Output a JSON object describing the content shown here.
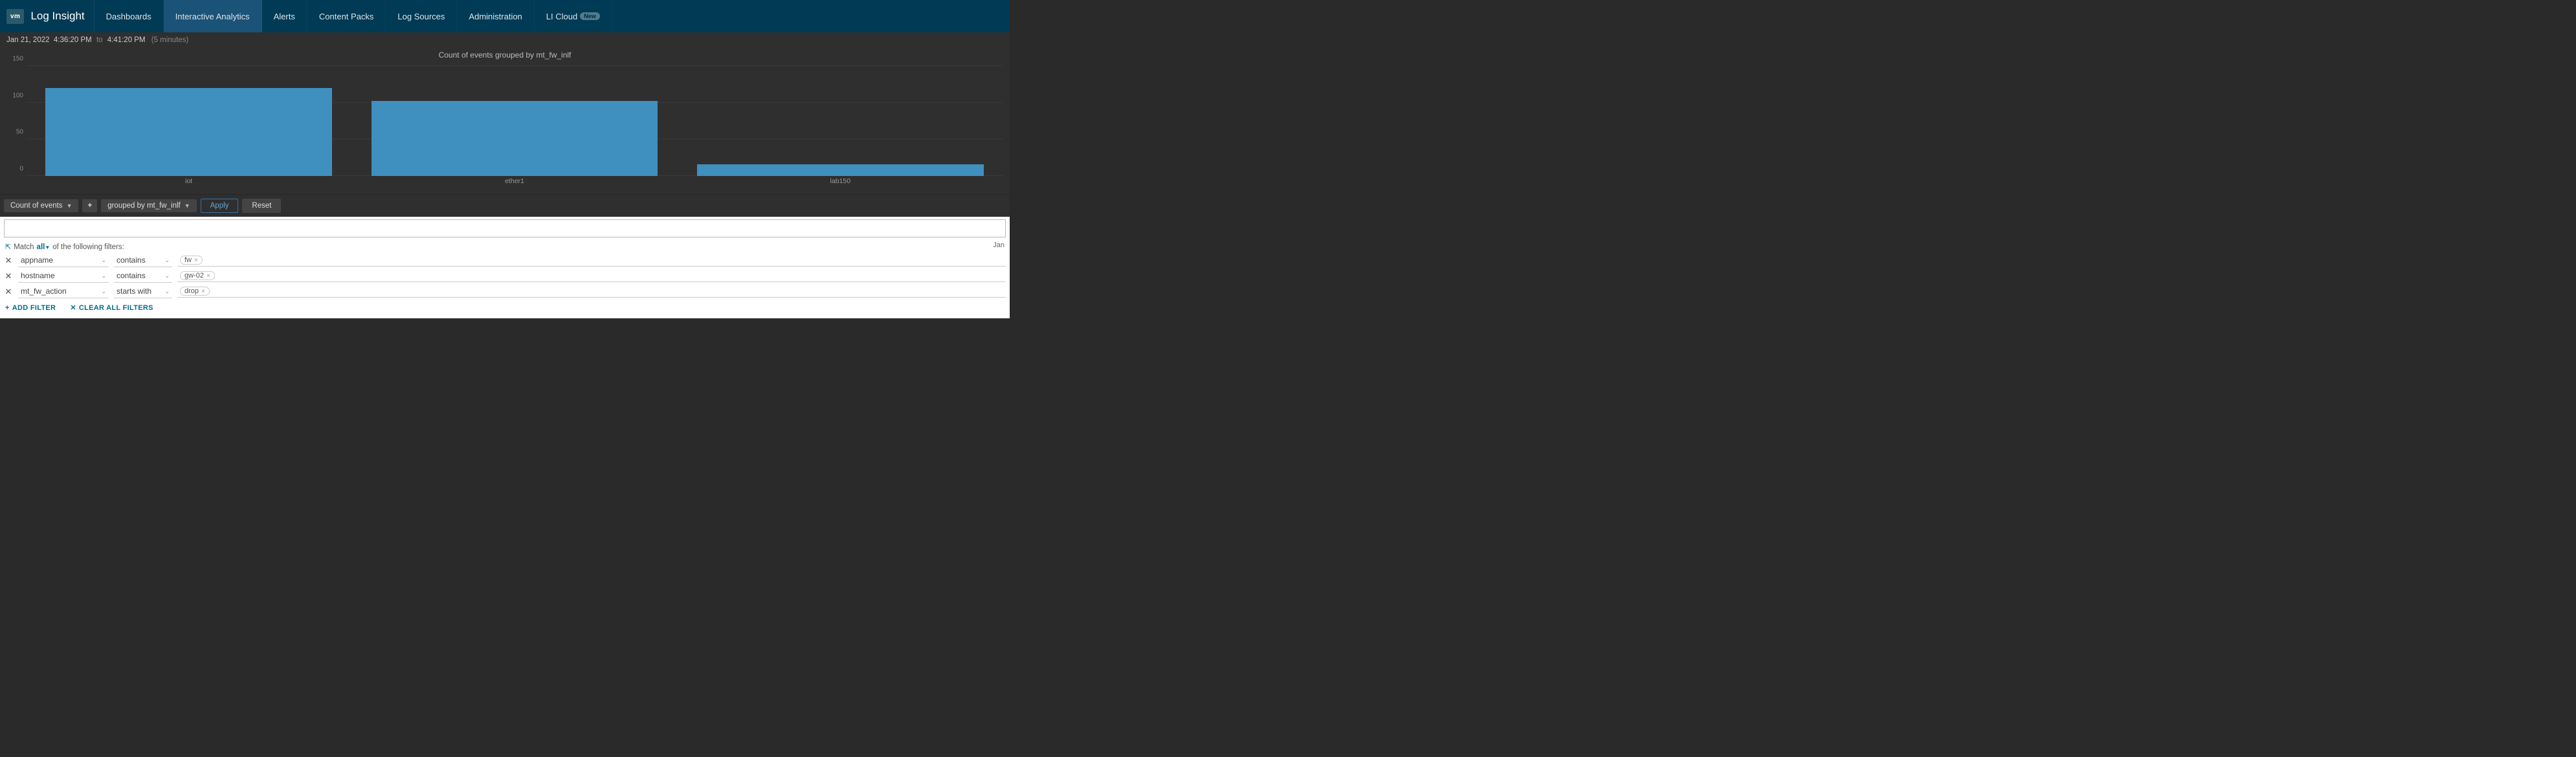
{
  "brand": {
    "logo": "vm",
    "title": "Log Insight"
  },
  "nav": {
    "items": [
      "Dashboards",
      "Interactive Analytics",
      "Alerts",
      "Content Packs",
      "Log Sources",
      "Administration"
    ],
    "cloud_label": "LI Cloud",
    "cloud_badge": "New",
    "active_index": 1
  },
  "timebar": {
    "date": "Jan 21, 2022",
    "from": "4:36:20 PM",
    "to_word": "to",
    "to": "4:41:20 PM",
    "duration": "(5 minutes)"
  },
  "chart_data": {
    "type": "bar",
    "title": "Count of events grouped by mt_fw_inlf",
    "categories": [
      "iot",
      "ether1",
      "lab150"
    ],
    "values": [
      120,
      102,
      16
    ],
    "ylim": [
      0,
      150
    ],
    "yticks": [
      0,
      50,
      100,
      150
    ],
    "xlabel": "",
    "ylabel": ""
  },
  "controls": {
    "measure": "Count of events",
    "groupby": "grouped by mt_fw_inlf",
    "apply": "Apply",
    "reset": "Reset"
  },
  "search": {
    "value": "",
    "placeholder": ""
  },
  "match": {
    "prefix": "Match",
    "mode": "all",
    "suffix": "of the following filters:",
    "right_label": "Jan"
  },
  "filters": [
    {
      "field": "appname",
      "op": "contains",
      "value": "fw"
    },
    {
      "field": "hostname",
      "op": "contains",
      "value": "gw-02"
    },
    {
      "field": "mt_fw_action",
      "op": "starts with",
      "value": "drop"
    }
  ],
  "actions": {
    "add": "ADD FILTER",
    "clear": "CLEAR ALL FILTERS"
  }
}
